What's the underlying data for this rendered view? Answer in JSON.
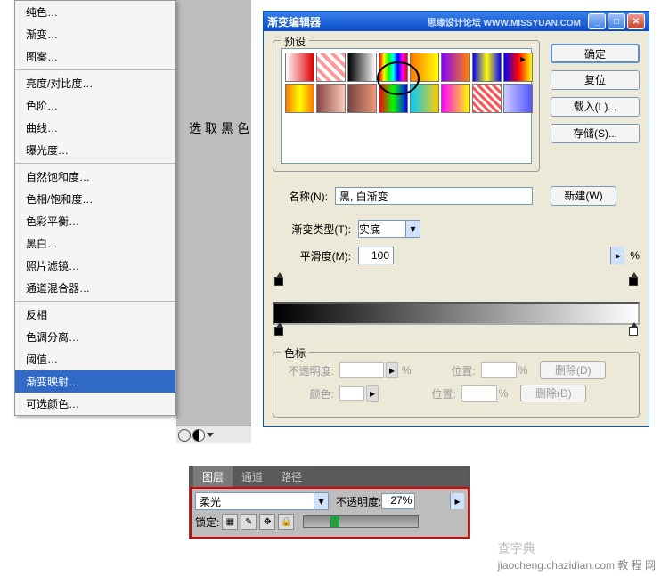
{
  "menu": {
    "items": [
      {
        "l": "纯色…"
      },
      {
        "l": "渐变…"
      },
      {
        "l": "图案…"
      },
      {
        "sep": true
      },
      {
        "l": "亮度/对比度…"
      },
      {
        "l": "色阶…"
      },
      {
        "l": "曲线…"
      },
      {
        "l": "曝光度…"
      },
      {
        "sep": true
      },
      {
        "l": "自然饱和度…"
      },
      {
        "l": "色相/饱和度…"
      },
      {
        "l": "色彩平衡…"
      },
      {
        "l": "黑白…"
      },
      {
        "l": "照片滤镜…"
      },
      {
        "l": "通道混合器…"
      },
      {
        "sep": true
      },
      {
        "l": "反相"
      },
      {
        "l": "色调分离…"
      },
      {
        "l": "阈值…"
      },
      {
        "l": "渐变映射…",
        "hi": true
      },
      {
        "l": "可选颜色…"
      }
    ]
  },
  "annotation": "选取黑色",
  "dialog": {
    "title": "渐变编辑器",
    "watermark": "思缘设计论坛   WWW.MISSYUAN.COM",
    "presets_label": "预设",
    "btn_ok": "确定",
    "btn_reset": "复位",
    "btn_load": "载入(L)...",
    "btn_save": "存储(S)...",
    "name_label": "名称(N):",
    "name_value": "黑, 白渐变",
    "btn_new": "新建(W)",
    "type_label": "渐变类型(T):",
    "type_value": "实底",
    "smooth_label": "平滑度(M):",
    "smooth_value": "100",
    "smooth_pct": "%",
    "stops_label": "色标",
    "opacity_label": "不透明度:",
    "opacity_pct": "%",
    "pos_label": "位置:",
    "pos_pct": "%",
    "color_label": "颜色:",
    "delete_btn": "删除(D)"
  },
  "panel": {
    "tabs": [
      "图层",
      "通道",
      "路径"
    ],
    "blend_value": "柔光",
    "opacity_label": "不透明度:",
    "opacity_value": "27%",
    "lock_label": "锁定:"
  },
  "footer": {
    "brand": "查字典",
    "sub": "jiaocheng.chazidian.com 教 程 网"
  }
}
